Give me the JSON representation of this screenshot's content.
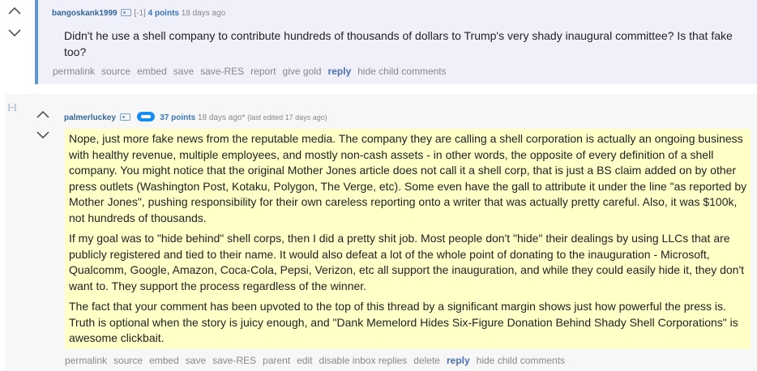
{
  "comment1": {
    "author": "bangoskank1999",
    "score_paren": "[-1]",
    "points": "4 points",
    "time": "18 days ago",
    "body": "Didn't he use a shell company to contribute hundreds of thousands of dollars to Trump's very shady inaugural committee? Is that fake too?",
    "actions": [
      "permalink",
      "source",
      "embed",
      "save",
      "save-RES",
      "report",
      "give gold",
      "reply",
      "hide child comments"
    ]
  },
  "comment2": {
    "collapse_label": "[–]",
    "author": "palmerluckey",
    "points": "37 points",
    "time": "18 days ago*",
    "edited": "(last edited 17 days ago)",
    "paragraphs": [
      "Nope, just more fake news from the reputable media. The company they are calling a shell corporation is actually an ongoing business with healthy revenue, multiple employees, and mostly non-cash assets - in other words, the opposite of every definition of a shell company. You might notice that the original Mother Jones article does not call it a shell corp, that is just a BS claim added on by other press outlets (Washington Post, Kotaku, Polygon, The Verge, etc). Some even have the gall to attribute it under the line \"as reported by Mother Jones\", pushing responsibility for their own careless reporting onto a writer that was actually pretty careful. Also, it was $100k, not hundreds of thousands.",
      "If my goal was to \"hide behind\" shell corps, then I did a pretty shit job. Most people don't \"hide\" their dealings by using LLCs that are publicly registered and tied to their name. It would also defeat a lot of the whole point of donating to the inauguration - Microsoft, Qualcomm, Google, Amazon, Coca-Cola, Pepsi, Verizon, etc all support the inauguration, and while they could easily hide it, they don't want to. They support the process regardless of the winner.",
      "The fact that your comment has been upvoted to the top of this thread by a significant margin shows just how powerful the press is. Truth is optional when the story is juicy enough, and \"Dank Memelord Hides Six-Figure Donation Behind Shady Shell Corporations\" is awesome clickbait."
    ],
    "actions": [
      "permalink",
      "source",
      "embed",
      "save",
      "save-RES",
      "parent",
      "edit",
      "disable inbox replies",
      "delete",
      "reply",
      "hide child comments"
    ]
  },
  "colors": {
    "comment1_bg": "#eff0fa",
    "comment1_bar": "#5f99cf",
    "comment2_bg": "#f7f7f8",
    "highlight": "#ffffc8",
    "author": "#336699",
    "reply": "#4a6fae"
  }
}
